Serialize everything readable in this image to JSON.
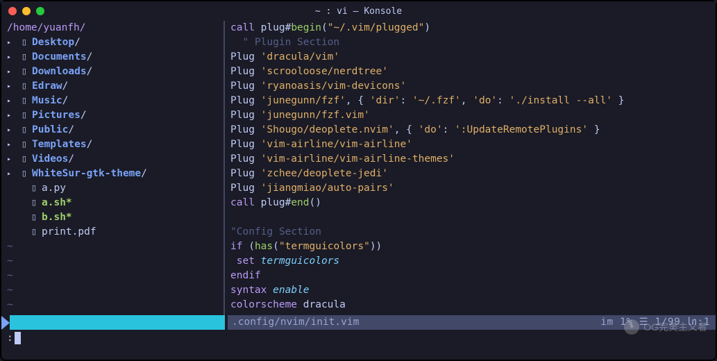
{
  "window": {
    "title": "~ : vi — Konsole"
  },
  "sidebar": {
    "path": "/home/yuanfh/",
    "items": [
      {
        "name": "Desktop",
        "type": "dir"
      },
      {
        "name": "Documents",
        "type": "dir"
      },
      {
        "name": "Downloads",
        "type": "dir"
      },
      {
        "name": "Edraw",
        "type": "dir"
      },
      {
        "name": "Music",
        "type": "dir"
      },
      {
        "name": "Pictures",
        "type": "dir"
      },
      {
        "name": "Public",
        "type": "dir"
      },
      {
        "name": "Templates",
        "type": "dir"
      },
      {
        "name": "Videos",
        "type": "dir"
      },
      {
        "name": "WhiteSur-gtk-theme",
        "type": "dir"
      },
      {
        "name": "a.py",
        "type": "file"
      },
      {
        "name": "a.sh",
        "type": "exec"
      },
      {
        "name": "b.sh",
        "type": "exec"
      },
      {
        "name": "print.pdf",
        "type": "file"
      }
    ]
  },
  "editor": {
    "lines": [
      {
        "t": "call",
        "s": [
          [
            "kw",
            "call"
          ],
          [
            "def",
            " plug#"
          ],
          [
            "fn",
            "begin"
          ],
          [
            "punct",
            "("
          ],
          [
            "str",
            "\"~/.vim/plugged\""
          ],
          [
            "punct",
            ")"
          ]
        ]
      },
      {
        "t": "comment",
        "s": [
          [
            "def",
            "  "
          ],
          [
            "comment",
            "\" Plugin Section"
          ]
        ]
      },
      {
        "t": "plug",
        "s": [
          [
            "def",
            "Plug "
          ],
          [
            "str",
            "'dracula/vim'"
          ]
        ]
      },
      {
        "t": "plug",
        "s": [
          [
            "def",
            "Plug "
          ],
          [
            "str",
            "'scrooloose/nerdtree'"
          ]
        ]
      },
      {
        "t": "plug",
        "s": [
          [
            "def",
            "Plug "
          ],
          [
            "str",
            "'ryanoasis/vim-devicons'"
          ]
        ]
      },
      {
        "t": "plug",
        "s": [
          [
            "def",
            "Plug "
          ],
          [
            "str",
            "'junegunn/fzf'"
          ],
          [
            "punct",
            ", { "
          ],
          [
            "str",
            "'dir'"
          ],
          [
            "punct",
            ": "
          ],
          [
            "str",
            "'~/.fzf'"
          ],
          [
            "punct",
            ", "
          ],
          [
            "str",
            "'do'"
          ],
          [
            "punct",
            ": "
          ],
          [
            "str",
            "'./install --all'"
          ],
          [
            "punct",
            " }"
          ]
        ]
      },
      {
        "t": "plug",
        "s": [
          [
            "def",
            "Plug "
          ],
          [
            "str",
            "'junegunn/fzf.vim'"
          ]
        ]
      },
      {
        "t": "plug",
        "s": [
          [
            "def",
            "Plug "
          ],
          [
            "str",
            "'Shougo/deoplete.nvim'"
          ],
          [
            "punct",
            ", { "
          ],
          [
            "str",
            "'do'"
          ],
          [
            "punct",
            ": "
          ],
          [
            "str",
            "':UpdateRemotePlugins'"
          ],
          [
            "punct",
            " }"
          ]
        ]
      },
      {
        "t": "plug",
        "s": [
          [
            "def",
            "Plug "
          ],
          [
            "str",
            "'vim-airline/vim-airline'"
          ]
        ]
      },
      {
        "t": "plug",
        "s": [
          [
            "def",
            "Plug "
          ],
          [
            "str",
            "'vim-airline/vim-airline-themes'"
          ]
        ]
      },
      {
        "t": "plug",
        "s": [
          [
            "def",
            "Plug "
          ],
          [
            "str",
            "'zchee/deoplete-jedi'"
          ]
        ]
      },
      {
        "t": "plug",
        "s": [
          [
            "def",
            "Plug "
          ],
          [
            "str",
            "'jiangmiao/auto-pairs'"
          ]
        ]
      },
      {
        "t": "call",
        "s": [
          [
            "kw",
            "call"
          ],
          [
            "def",
            " plug#"
          ],
          [
            "fn",
            "end"
          ],
          [
            "punct",
            "()"
          ]
        ]
      },
      {
        "t": "blank",
        "s": [
          [
            "def",
            " "
          ]
        ]
      },
      {
        "t": "comment",
        "s": [
          [
            "comment",
            "\"Config Section"
          ]
        ]
      },
      {
        "t": "if",
        "s": [
          [
            "kw",
            "if"
          ],
          [
            "def",
            " ("
          ],
          [
            "fn",
            "has"
          ],
          [
            "punct",
            "("
          ],
          [
            "str",
            "\"termguicolors\""
          ],
          [
            "punct",
            "))"
          ]
        ]
      },
      {
        "t": "set",
        "s": [
          [
            "def",
            " "
          ],
          [
            "stmt",
            "set"
          ],
          [
            "def",
            " "
          ],
          [
            "tgc",
            "termguicolors"
          ]
        ]
      },
      {
        "t": "endif",
        "s": [
          [
            "kw",
            "endif"
          ]
        ]
      },
      {
        "t": "syntax",
        "s": [
          [
            "stmt",
            "syntax"
          ],
          [
            "def",
            " "
          ],
          [
            "enable",
            "enable"
          ]
        ]
      },
      {
        "t": "cs",
        "s": [
          [
            "stmt",
            "colorscheme"
          ],
          [
            "def",
            " dracula"
          ]
        ]
      }
    ]
  },
  "status": {
    "file": ".config/nvim/init.vim",
    "right": "im     1% ☰ 1/99 ㏑:1"
  },
  "cmdline": {
    "prompt": ":"
  },
  "watermark": {
    "text": "OG完美主义者"
  }
}
